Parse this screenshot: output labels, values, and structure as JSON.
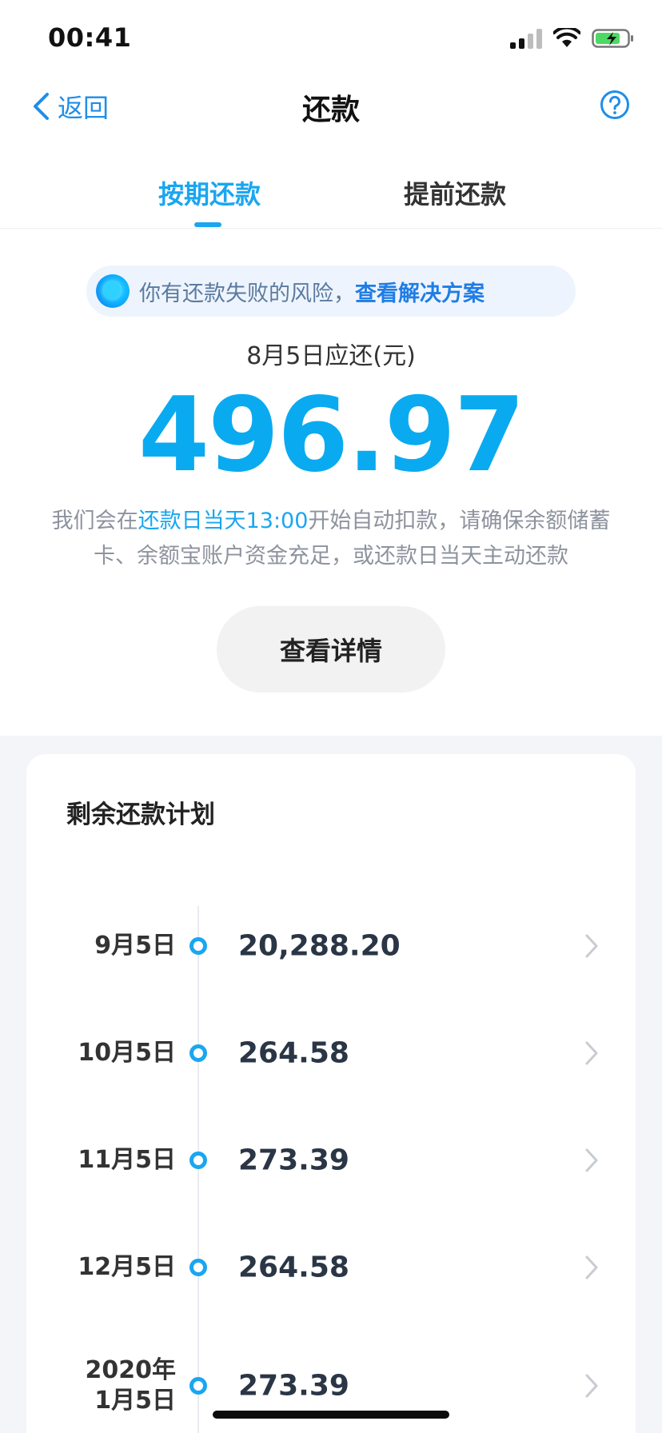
{
  "status": {
    "time": "00:41"
  },
  "nav": {
    "back_label": "返回",
    "title": "还款",
    "help_icon": "question-circle-icon"
  },
  "tabs": [
    {
      "label": "按期还款",
      "active": true
    },
    {
      "label": "提前还款",
      "active": false
    }
  ],
  "risk": {
    "text": "你有还款失败的风险，",
    "link": "查看解决方案"
  },
  "due": {
    "label": "8月5日应还(元)",
    "amount": "496.97"
  },
  "description": {
    "part1": "我们会在",
    "highlight": "还款日当天13:00",
    "part2": "开始自动扣款，请确保余额储蓄卡、余额宝账户资金充足，或还款日当天主动还款"
  },
  "details_button": "查看详情",
  "plan": {
    "title": "剩余还款计划",
    "items": [
      {
        "date": "9月5日",
        "amount": "20,288.20"
      },
      {
        "date": "10月5日",
        "amount": "264.58"
      },
      {
        "date": "11月5日",
        "amount": "273.39"
      },
      {
        "date": "12月5日",
        "amount": "264.58"
      },
      {
        "date_line1": "2020年",
        "date_line2": "1月5日",
        "amount": "273.39"
      }
    ]
  },
  "colors": {
    "accent": "#1aa6f0",
    "link": "#1f7de6",
    "background": "#f4f5f9"
  }
}
